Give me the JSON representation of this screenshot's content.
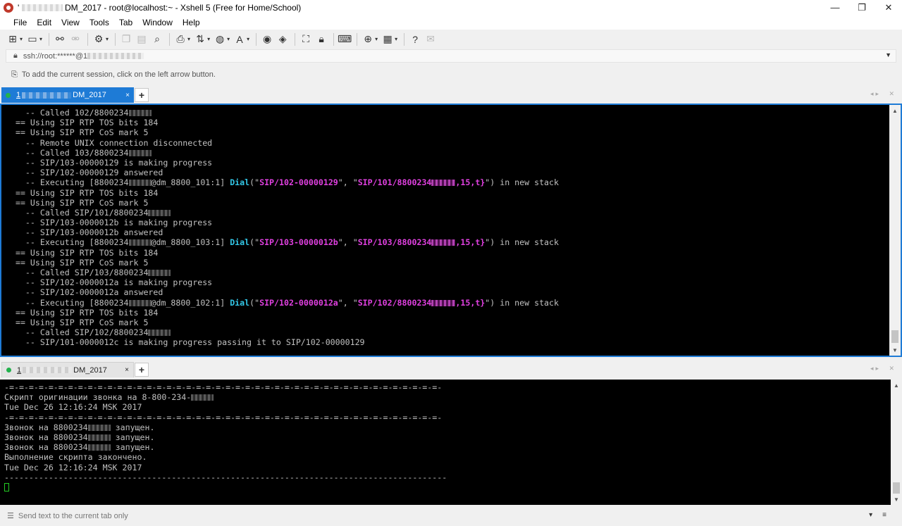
{
  "window": {
    "title_prefix": "'",
    "title_main": "DM_2017 - root@localhost:~ - Xshell 5 (Free for Home/School)",
    "minimize": "—",
    "restore": "❐",
    "close": "✕"
  },
  "menu": [
    {
      "key": "F",
      "rest": "ile"
    },
    {
      "key": "E",
      "rest": "dit"
    },
    {
      "key": "V",
      "rest": "iew"
    },
    {
      "key": "T",
      "rest": "ools"
    },
    {
      "key": "T",
      "rest": "ab",
      "alt": "Tab"
    },
    {
      "key": "W",
      "rest": "indow"
    },
    {
      "key": "H",
      "rest": "elp"
    }
  ],
  "menu_labels": [
    "File",
    "Edit",
    "View",
    "Tools",
    "Tab",
    "Window",
    "Help"
  ],
  "address": {
    "text": "ssh://root:******@1"
  },
  "hint": {
    "text": "To add the current session, click on the left arrow button."
  },
  "tabs_top": {
    "number": "1",
    "suffix": "DM_2017",
    "close": "×",
    "add": "+"
  },
  "tabs_bottom": {
    "number": "1",
    "suffix": "DM_2017",
    "close": "×",
    "add": "+"
  },
  "terminal_top": {
    "lines": [
      [
        "    -- Called 102/8800234",
        "B"
      ],
      [
        "  == Using SIP RTP TOS bits 184"
      ],
      [
        "  == Using SIP RTP CoS mark 5"
      ],
      [
        "    -- Remote UNIX connection disconnected"
      ],
      [
        "    -- Called 103/8800234",
        "B"
      ],
      [
        "    -- SIP/103-00000129 is making progress"
      ],
      [
        "    -- SIP/102-00000129 answered"
      ],
      [
        "    -- Executing [8800234",
        "B",
        "@dm_8800_101:1] ",
        "C:Dial",
        "(\"",
        "M:SIP/102-00000129",
        "\", \"",
        "M:SIP/101/8800234",
        "BM",
        "M:,15,t}",
        "\") in new stack"
      ],
      [
        "  == Using SIP RTP TOS bits 184"
      ],
      [
        "  == Using SIP RTP CoS mark 5"
      ],
      [
        "    -- Called SIP/101/8800234",
        "B"
      ],
      [
        "    -- SIP/103-0000012b is making progress"
      ],
      [
        "    -- SIP/103-0000012b answered"
      ],
      [
        "    -- Executing [8800234",
        "B",
        "@dm_8800_103:1] ",
        "C:Dial",
        "(\"",
        "M:SIP/103-0000012b",
        "\", \"",
        "M:SIP/103/8800234",
        "BM",
        "M:,15,t}",
        "\") in new stack"
      ],
      [
        "  == Using SIP RTP TOS bits 184"
      ],
      [
        "  == Using SIP RTP CoS mark 5"
      ],
      [
        "    -- Called SIP/103/8800234",
        "B"
      ],
      [
        "    -- SIP/102-0000012a is making progress"
      ],
      [
        "    -- SIP/102-0000012a answered"
      ],
      [
        "    -- Executing [8800234",
        "B",
        "@dm_8800_102:1] ",
        "C:Dial",
        "(\"",
        "M:SIP/102-0000012a",
        "\", \"",
        "M:SIP/102/8800234",
        "BM",
        "M:,15,t}",
        "\") in new stack"
      ],
      [
        "  == Using SIP RTP TOS bits 184"
      ],
      [
        "  == Using SIP RTP CoS mark 5"
      ],
      [
        "    -- Called SIP/102/8800234",
        "B"
      ],
      [
        "    -- SIP/101-0000012c is making progress passing it to SIP/102-00000129"
      ]
    ]
  },
  "terminal_bottom": {
    "lines": [
      [
        "-=-=-=-=-=-=-=-=-=-=-=-=-=-=-=-=-=-=-=-=-=-=-=-=-=-=-=-=-=-=-=-=-=-=-=-=-=-=-=-=-=-=-=-=-"
      ],
      [
        "Скрипт оригинации звонка на 8-800-234-",
        "B"
      ],
      [
        "Tue Dec 26 12:16:24 MSK 2017"
      ],
      [
        "-=-=-=-=-=-=-=-=-=-=-=-=-=-=-=-=-=-=-=-=-=-=-=-=-=-=-=-=-=-=-=-=-=-=-=-=-=-=-=-=-=-=-=-=-"
      ],
      [
        "Звонок на 8800234",
        "B",
        " запущен."
      ],
      [
        "Звонок на 8800234",
        "B",
        " запущен."
      ],
      [
        "Звонок на 8800234",
        "B",
        " запущен."
      ],
      [
        "Выполнение скрипта закончено."
      ],
      [
        "Tue Dec 26 12:16:24 MSK 2017"
      ],
      [
        "------------------------------------------------------------------------------------------"
      ],
      [
        "CURSOR"
      ]
    ]
  },
  "status": {
    "text": "Send text to the current tab only"
  },
  "colors": {
    "tab_active": "#1e7bd6",
    "cyan": "#33c8e8",
    "magenta": "#e040e0",
    "terminal_bg": "#000000",
    "terminal_fg": "#c0c0c0"
  }
}
